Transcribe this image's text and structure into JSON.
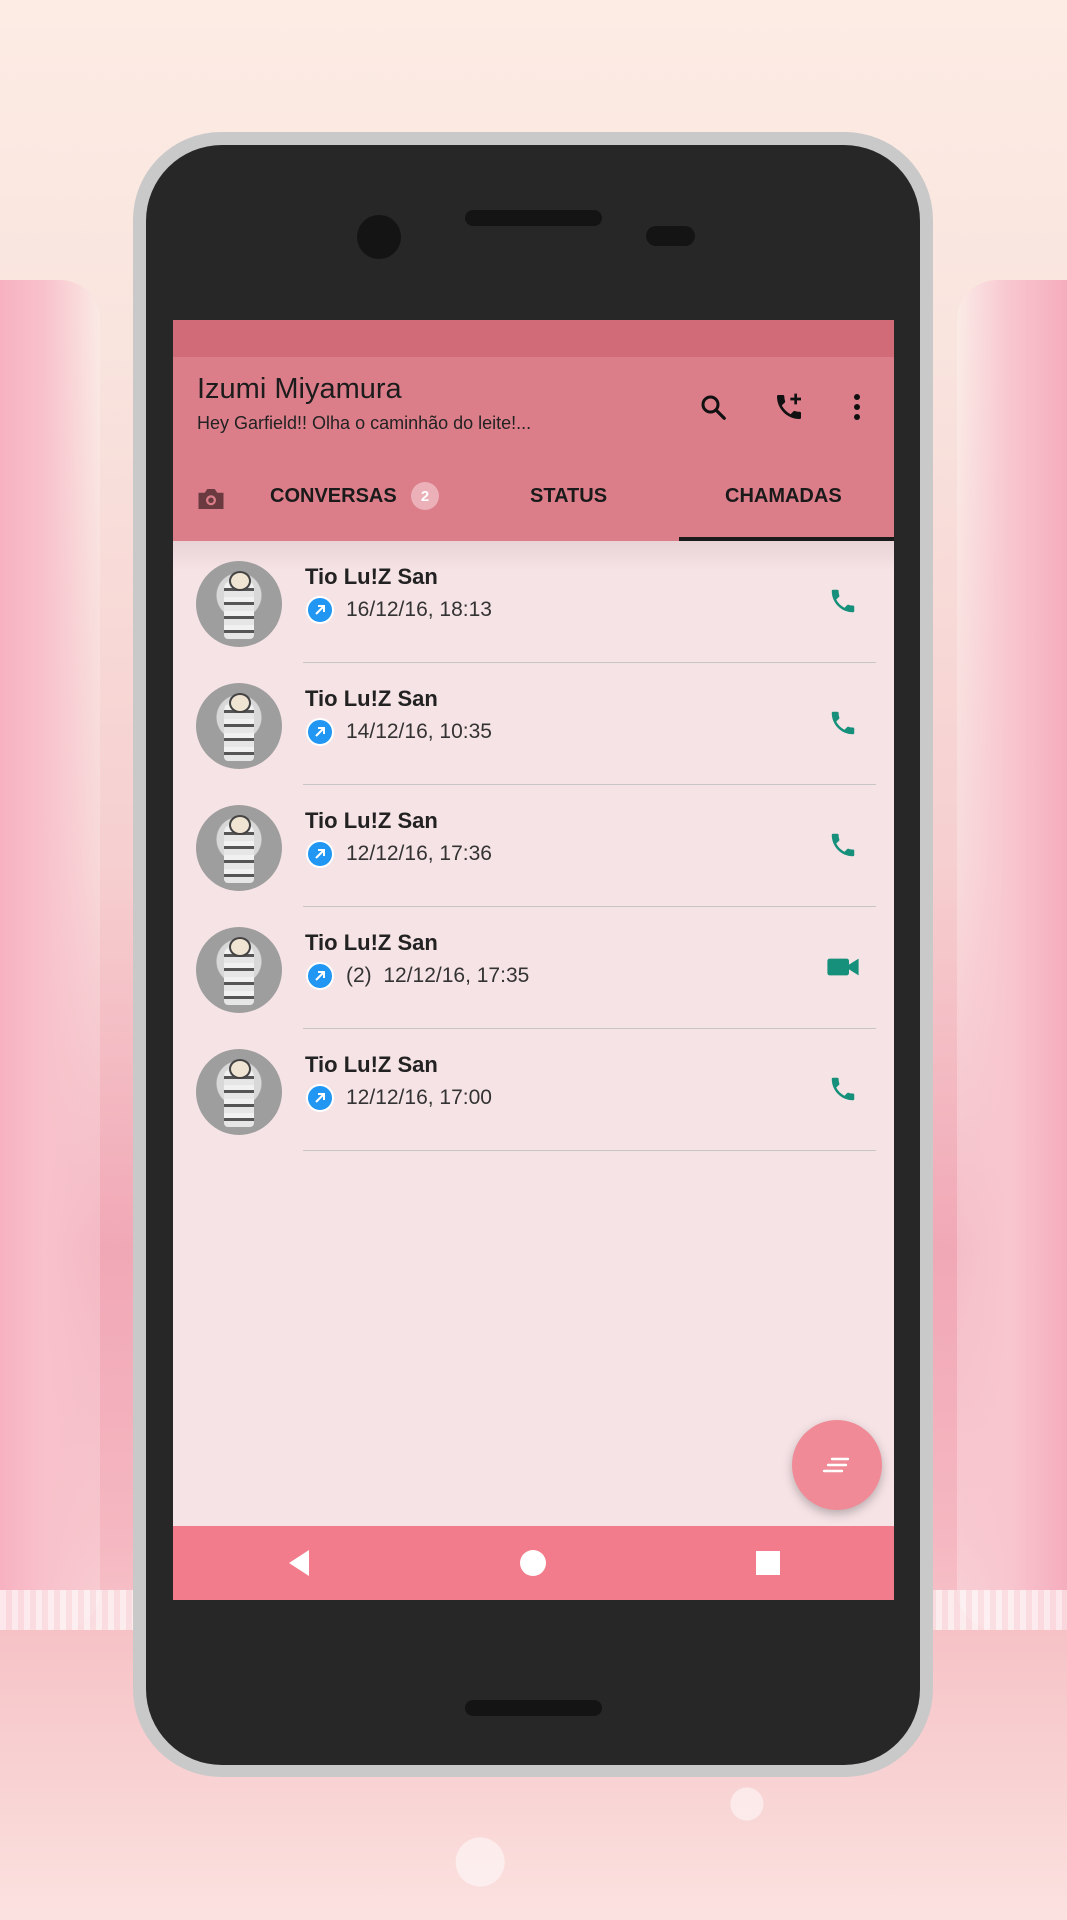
{
  "header": {
    "title": "Izumi Miyamura",
    "subtitle": "Hey Garfield!! Olha o caminhão do leite!..."
  },
  "header_icons": [
    "search-icon",
    "add-call-icon",
    "more-vert-icon"
  ],
  "tabs": [
    {
      "label": "CONVERSAS",
      "badge": "2"
    },
    {
      "label": "STATUS"
    },
    {
      "label": "CHAMADAS",
      "selected": true
    }
  ],
  "calls": [
    {
      "name": "Tio Lu!Z San",
      "meta": "16/12/16, 18:13",
      "type": "voice"
    },
    {
      "name": "Tio Lu!Z San",
      "meta": "14/12/16, 10:35",
      "type": "voice"
    },
    {
      "name": "Tio Lu!Z San",
      "meta": "12/12/16, 17:36",
      "type": "voice"
    },
    {
      "name": "Tio Lu!Z San",
      "meta": "(2)  12/12/16, 17:35",
      "type": "video"
    },
    {
      "name": "Tio Lu!Z San",
      "meta": "12/12/16, 17:00",
      "type": "voice"
    }
  ],
  "colors": {
    "appbar": "#dc7e8a",
    "statusbar": "#d16b78",
    "list_bg": "#f6e3e6",
    "call_icon": "#16907a",
    "outgoing_arrow": "#2196f3",
    "fab": "#f08a96",
    "navbar": "#f27c8b"
  }
}
